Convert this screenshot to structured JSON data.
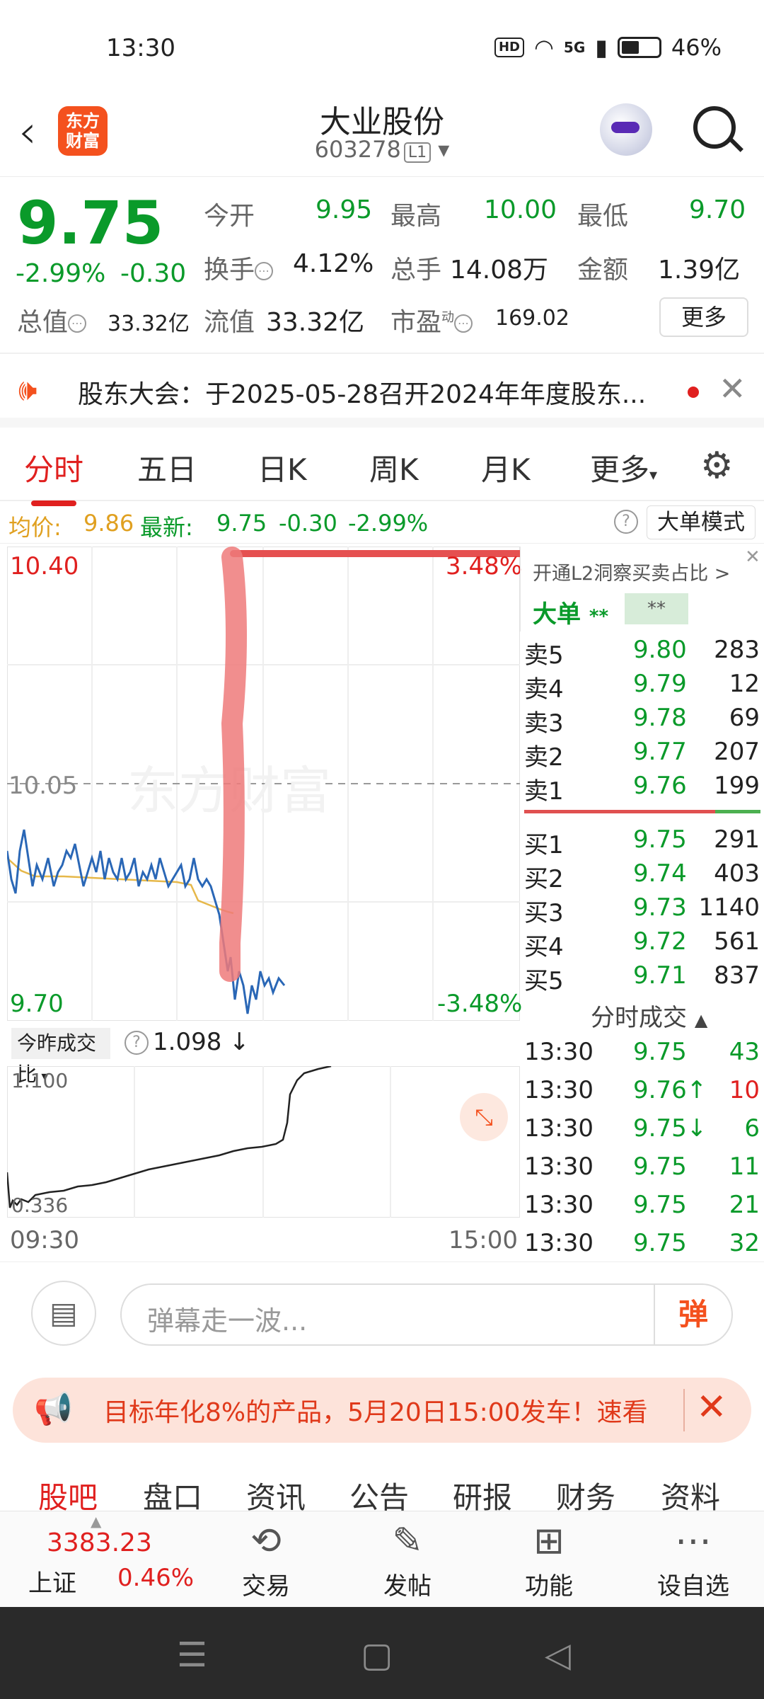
{
  "status": {
    "time": "13:30",
    "hd": "HD",
    "network": "5G",
    "battery": "46%"
  },
  "header": {
    "logo": "东方财富",
    "title": "大业股份",
    "code": "603278",
    "level": "L1"
  },
  "quote": {
    "price": "9.75",
    "change_pct": "-2.99%",
    "change": "-0.30",
    "open_label": "今开",
    "open": "9.95",
    "high_label": "最高",
    "high": "10.00",
    "low_label": "最低",
    "low": "9.70",
    "turnover_label": "换手",
    "turnover": "4.12%",
    "volume_label": "总手",
    "volume": "14.08万",
    "amount_label": "金额",
    "amount": "1.39亿",
    "mktcap_label": "总值",
    "mktcap": "33.32亿",
    "float_label": "流值",
    "float": "33.32亿",
    "pe_label": "市盈",
    "pe_sup": "动",
    "pe": "169.02",
    "more": "更多"
  },
  "notice": {
    "text": "股东大会：于2025-05-28召开2024年年度股东..."
  },
  "tabs": [
    "分时",
    "五日",
    "日K",
    "周K",
    "月K",
    "更多"
  ],
  "avg": {
    "avg_label": "均价:",
    "avg": "9.86",
    "latest_label": "最新:",
    "latest": "9.75",
    "chg": "-0.30",
    "pct": "-2.99%",
    "mode": "大单模式"
  },
  "chart": {
    "top_price": "10.40",
    "top_pct": "3.48%",
    "mid_price": "10.05",
    "bottom_price": "9.70",
    "bottom_pct": "-3.48%",
    "watermark": "东方财富"
  },
  "book": {
    "l2": "开通L2洞察买卖占比 >",
    "bigorder": "大单",
    "stars": "**",
    "box": "**",
    "sell": [
      [
        "卖5",
        "9.80",
        "283"
      ],
      [
        "卖4",
        "9.79",
        "12"
      ],
      [
        "卖3",
        "9.78",
        "69"
      ],
      [
        "卖2",
        "9.77",
        "207"
      ],
      [
        "卖1",
        "9.76",
        "199"
      ]
    ],
    "buy": [
      [
        "买1",
        "9.75",
        "291"
      ],
      [
        "买2",
        "9.74",
        "403"
      ],
      [
        "买3",
        "9.73",
        "1140"
      ],
      [
        "买4",
        "9.72",
        "561"
      ],
      [
        "买5",
        "9.71",
        "837"
      ]
    ],
    "ticks_title": "分时成交",
    "ticks": [
      [
        "13:30",
        "9.75",
        "43"
      ],
      [
        "13:30",
        "9.76↑",
        "10"
      ],
      [
        "13:30",
        "9.75↓",
        "6"
      ],
      [
        "13:30",
        "9.75",
        "11"
      ],
      [
        "13:30",
        "9.75",
        "21"
      ],
      [
        "13:30",
        "9.75",
        "32"
      ]
    ]
  },
  "ratio": {
    "label": "今昨成交比",
    "value": "1.098",
    "top": "1.100",
    "bottom": "0.336",
    "start": "09:30",
    "end": "15:00"
  },
  "comment": {
    "placeholder": "弹幕走一波...",
    "dan": "弹"
  },
  "ad": {
    "text": "目标年化8%的产品，5月20日15:00发车！速看"
  },
  "btabs": [
    "股吧",
    "盘口",
    "资讯",
    "公告",
    "研报",
    "财务",
    "资料"
  ],
  "footer": {
    "index_value": "3383.23",
    "index_name": "上证",
    "index_pct": "0.46%",
    "items": [
      "交易",
      "发帖",
      "功能",
      "设自选"
    ]
  },
  "colors": {
    "up": "#e0201f",
    "down": "#0a9a2a",
    "accent": "#f4511e"
  }
}
